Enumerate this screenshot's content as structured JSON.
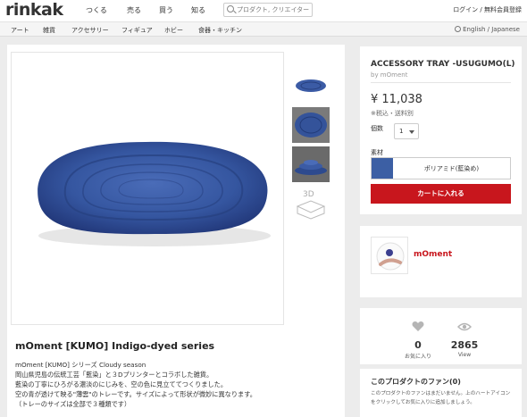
{
  "header": {
    "logo": "rinkak",
    "nav": [
      "つくる",
      "売る",
      "買う",
      "知る"
    ],
    "search_placeholder": "プロダクト, クリエイター",
    "auth": "ログイン / 無料会員登録"
  },
  "category_bar": {
    "items": [
      "アート",
      "雑貨",
      "アクセサリー",
      "フィギュア",
      "ホビー",
      "食器・キッチン"
    ],
    "language": "English / Japanese"
  },
  "product": {
    "title": "mOment [KUMO] Indigo-dyed series",
    "description": [
      "mOment [KUMO] シリーズ Cloudy season",
      "岡山県児島の伝統工芸「藍染」と３Dプリンターとコラボした雑貨。",
      "藍染の丁寧にひろがる濃淡のにじみを、空の色に見立ててつくりました。",
      "空の青が透けて映る\"薄雲\"のトレーです。サイズによって形状が微妙に異なります。",
      "（トレーのサイズは全部で３種類です）"
    ],
    "thumb_3d_label": "3D"
  },
  "buy_box": {
    "title": "ACCESSORY TRAY -USUGUMO(L)",
    "by": "by mOment",
    "price": "¥ 11,038",
    "tax_note": "※税込・送料別",
    "quantity_label": "個数",
    "quantity_value": "1",
    "material_label": "素材",
    "material_name": "ポリアミド(藍染め)",
    "cart_button": "カートに入れる"
  },
  "creator": {
    "name": "mOment"
  },
  "stats": {
    "favorites_count": "0",
    "favorites_label": "お気に入り",
    "views_count": "2865",
    "views_label": "View"
  },
  "fans": {
    "title": "このプロダクトのファン(0)",
    "text": "このプロダクトのファンはまだいません。上のハートアイコンをクリックしてお気に入りに追加しましょう。"
  },
  "colors": {
    "accent": "#c8161d",
    "indigo": "#3c5fa4"
  }
}
